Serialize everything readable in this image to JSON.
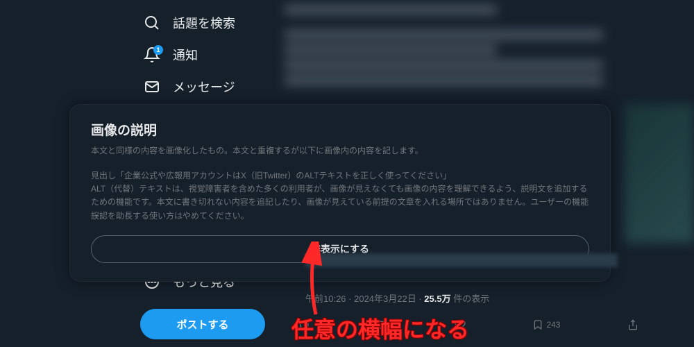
{
  "sidebar": {
    "items": [
      {
        "icon": "search-icon",
        "label": "話題を検索"
      },
      {
        "icon": "bell-icon",
        "label": "通知",
        "badge": "1"
      },
      {
        "icon": "mail-icon",
        "label": "メッセージ"
      },
      {
        "icon": "more-icon",
        "label": "もっと見る"
      }
    ]
  },
  "post_button": "ポストする",
  "modal": {
    "title": "画像の説明",
    "subtitle": "本文と同様の内容を画像化したもの。本文と重複するが以下に画像内の内容を記します。",
    "body_line1": "見出し「企業公式や広報用アカウントはX（旧Twitter）のALTテキストを正しく使ってください」",
    "body_line2": "ALT（代替）テキストは、視覚障害者を含めた多くの利用者が、画像が見えなくても画像の内容を理解できるよう、説明文を追加するための機能です。本文に書き切れない内容を追記したり、画像が見えている前提の文章を入れる場所ではありません。ユーザーの機能誤認を助長する使い方はやめてください。",
    "hide_button": "非表示にする"
  },
  "meta": {
    "time": "午前10:26",
    "date": "2024年3月22日",
    "views_count": "25.5万",
    "views_label": "件の表示"
  },
  "actions": {
    "bookmark": "243"
  },
  "annotation": "任意の横幅になる"
}
